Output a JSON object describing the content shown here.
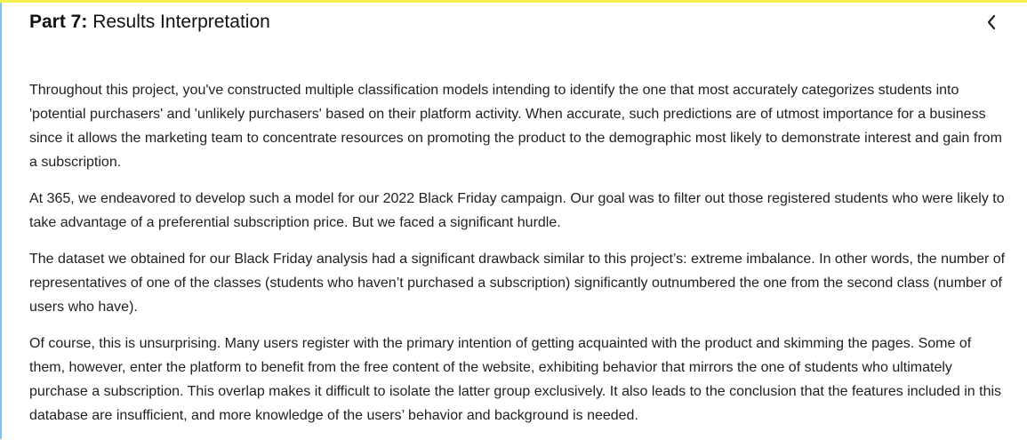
{
  "section": {
    "title_prefix": "Part 7:",
    "title_text": "Results Interpretation",
    "collapse_icon": "chevron-left-icon"
  },
  "paragraphs": [
    "Throughout this project, you've constructed multiple classification models intending to identify the one that most accurately categorizes students into 'potential purchasers' and 'unlikely purchasers' based on their platform activity. When accurate, such predictions are of utmost importance for a business since it allows the marketing team to concentrate resources on promoting the product to the demographic most likely to demonstrate interest and gain from a subscription.",
    "At 365, we endeavored to develop such a model for our 2022 Black Friday campaign. Our goal was to filter out those registered students who were likely to take advantage of a preferential subscription price. But we faced a significant hurdle.",
    "The dataset we obtained for our Black Friday analysis had a significant drawback similar to this project’s: extreme imbalance. In other words, the number of representatives of one of the classes (students who haven’t purchased a subscription) significantly outnumbered the one from the second class (number of users who have).",
    "Of course, this is unsurprising. Many users register with the primary intention of getting acquainted with the product and skimming the pages. Some of them, however, enter the platform to benefit from the free content of the website, exhibiting behavior that mirrors the one of students who ultimately purchase a subscription. This overlap makes it difficult to isolate the latter group exclusively. It also leads to the conclusion that the features included in this database are insufficient, and more knowledge of the users’ behavior and background is needed."
  ]
}
